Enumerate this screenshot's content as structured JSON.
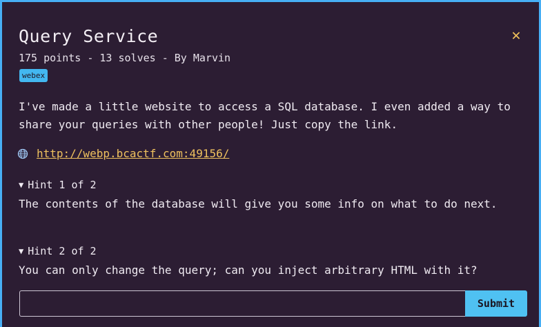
{
  "challenge": {
    "title": "Query Service",
    "meta": "175 points - 13 solves - By Marvin",
    "tag": "webex",
    "description": "I've made a little website to access a SQL database. I even added a way to share your queries with other people! Just copy the link.",
    "link": "http://webp.bcactf.com:49156/",
    "close_icon": "close-icon",
    "globe_icon": "globe-icon"
  },
  "hints": [
    {
      "label": "Hint 1 of 2",
      "text": "The contents of the database will give you some info on what to do next."
    },
    {
      "label": "Hint 2 of 2",
      "text": "You can only change the query; can you inject arbitrary HTML with it?"
    }
  ],
  "form": {
    "input_value": "",
    "input_placeholder": "",
    "submit_label": "Submit"
  },
  "colors": {
    "border": "#47aff5",
    "background": "#2c1d33",
    "accent": "#efc15e",
    "tag_bg": "#43b7f0",
    "button_bg": "#4fc1f2"
  }
}
